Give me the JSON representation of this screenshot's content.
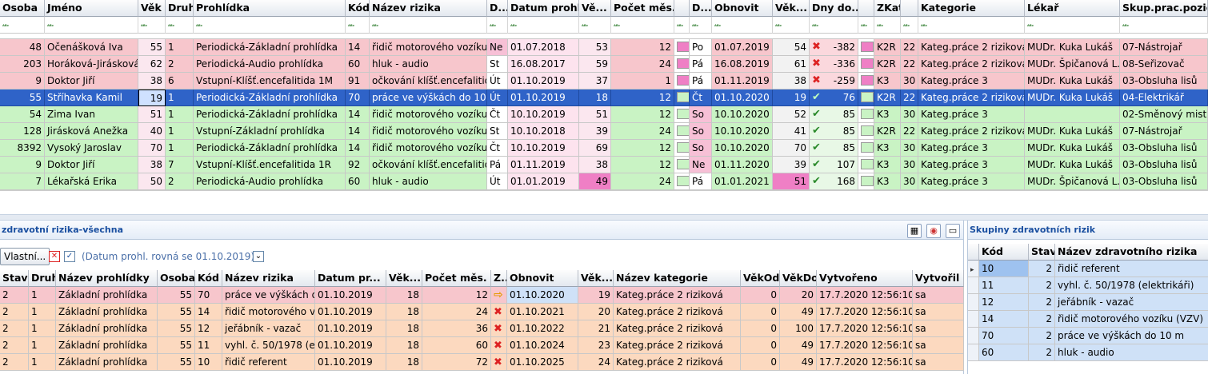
{
  "main_grid": {
    "columns": [
      "Osoba",
      "Jméno",
      "Věk",
      "Druh",
      "Prohlídka",
      "Kód",
      "Název rizika",
      "D...",
      "Datum prohl.",
      "Vě...",
      "Počet měs.",
      "",
      "D...",
      "Obnovit",
      "Věk...",
      "Dny do...",
      "",
      "ZKat",
      "",
      "Kategorie",
      "Lékař",
      "Skup.prac.pozic."
    ],
    "rows": [
      {
        "osoba": "48",
        "jmeno": "Očenášková Iva",
        "vek": "55",
        "druh": "1",
        "prohlidka": "Periodická-Základní prohlídka",
        "kod": "14",
        "riziko": "řidič motorového vozíku (",
        "d1": "Ne",
        "datum": "01.07.2018",
        "ve": "53",
        "pocet": "12",
        "d2": "Po",
        "obnovit": "01.07.2019",
        "vek2": "54",
        "stav": "x",
        "dny": "-382",
        "zkat": "K2R",
        "k": "22",
        "kategorie": "Kateg.práce 2 riziková",
        "lekar": "MUDr. Kuka Lukáš",
        "skup": "07-Nástrojař"
      },
      {
        "osoba": "203",
        "jmeno": "Horáková-Jirásková",
        "vek": "62",
        "druh": "2",
        "prohlidka": "Periodická-Audio     prohlídka",
        "kod": "60",
        "riziko": "hluk - audio",
        "d1": "St",
        "datum": "16.08.2017",
        "ve": "59",
        "pocet": "24",
        "d2": "Pá",
        "obnovit": "16.08.2019",
        "vek2": "61",
        "stav": "x",
        "dny": "-336",
        "zkat": "K2R",
        "k": "22",
        "kategorie": "Kateg.práce 2 riziková",
        "lekar": "MUDr. Špičanová L.",
        "skup": "08-Seřizovač"
      },
      {
        "osoba": "9",
        "jmeno": "Doktor Jiří",
        "vek": "38",
        "druh": "6",
        "prohlidka": "Vstupní-Klíšť.encefalitida 1M",
        "kod": "91",
        "riziko": "očkování klíšť.encefalitid",
        "d1": "Út",
        "datum": "01.10.2019",
        "ve": "37",
        "pocet": "1",
        "d2": "Pá",
        "obnovit": "01.11.2019",
        "vek2": "38",
        "stav": "x",
        "dny": "-259",
        "zkat": "K3",
        "k": "30",
        "kategorie": "Kateg.práce 3",
        "lekar": "MUDr. Kuka Lukáš",
        "skup": "03-Obsluha lisů"
      },
      {
        "osoba": "55",
        "jmeno": "Stříhavka Kamil",
        "vek": "19",
        "druh": "1",
        "prohlidka": "Periodická-Základní prohlídka",
        "kod": "70",
        "riziko": "práce ve výškách do 10 m",
        "d1": "Út",
        "datum": "01.10.2019",
        "ve": "18",
        "pocet": "12",
        "d2": "Čt",
        "obnovit": "01.10.2020",
        "vek2": "19",
        "stav": "ok",
        "dny": "76",
        "zkat": "K2R",
        "k": "22",
        "kategorie": "Kateg.práce 2 riziková",
        "lekar": "MUDr. Kuka Lukáš",
        "skup": "04-Elektrikář"
      },
      {
        "osoba": "54",
        "jmeno": "Zima Ivan",
        "vek": "51",
        "druh": "1",
        "prohlidka": "Periodická-Základní prohlídka",
        "kod": "14",
        "riziko": "řidič motorového vozíku (",
        "d1": "Čt",
        "datum": "10.10.2019",
        "ve": "51",
        "pocet": "12",
        "d2": "So",
        "obnovit": "10.10.2020",
        "vek2": "52",
        "stav": "ok",
        "dny": "85",
        "zkat": "K3",
        "k": "30",
        "kategorie": "Kateg.práce 3",
        "lekar": "",
        "skup": "02-Směnový mistr"
      },
      {
        "osoba": "128",
        "jmeno": "Jirásková Anežka",
        "vek": "40",
        "druh": "1",
        "prohlidka": "Vstupní-Základní prohlídka",
        "kod": "14",
        "riziko": "řidič motorového vozíku (",
        "d1": "St",
        "datum": "10.10.2018",
        "ve": "39",
        "pocet": "24",
        "d2": "So",
        "obnovit": "10.10.2020",
        "vek2": "41",
        "stav": "ok",
        "dny": "85",
        "zkat": "K2R",
        "k": "22",
        "kategorie": "Kateg.práce 2 riziková",
        "lekar": "MUDr. Kuka Lukáš",
        "skup": "07-Nástrojař"
      },
      {
        "osoba": "8392",
        "jmeno": "Vysoký Jaroslav",
        "vek": "70",
        "druh": "1",
        "prohlidka": "Periodická-Základní prohlídka",
        "kod": "14",
        "riziko": "řidič motorového vozíku (",
        "d1": "Čt",
        "datum": "10.10.2019",
        "ve": "69",
        "pocet": "12",
        "d2": "So",
        "obnovit": "10.10.2020",
        "vek2": "70",
        "stav": "ok",
        "dny": "85",
        "zkat": "K3",
        "k": "30",
        "kategorie": "Kateg.práce 3",
        "lekar": "MUDr. Kuka Lukáš",
        "skup": "03-Obsluha lisů"
      },
      {
        "osoba": "9",
        "jmeno": "Doktor Jiří",
        "vek": "38",
        "druh": "7",
        "prohlidka": "Vstupní-Klíšť.encefalitida 1R",
        "kod": "92",
        "riziko": "očkování klíšť.encefalitid",
        "d1": "Pá",
        "datum": "01.11.2019",
        "ve": "38",
        "pocet": "12",
        "d2": "Ne",
        "obnovit": "01.11.2020",
        "vek2": "39",
        "stav": "ok",
        "dny": "107",
        "zkat": "K3",
        "k": "30",
        "kategorie": "Kateg.práce 3",
        "lekar": "MUDr. Kuka Lukáš",
        "skup": "03-Obsluha lisů"
      },
      {
        "osoba": "7",
        "jmeno": "Lékařská Erika",
        "vek": "50",
        "druh": "2",
        "prohlidka": "Periodická-Audio     prohlídka",
        "kod": "60",
        "riziko": "hluk - audio",
        "d1": "Út",
        "datum": "01.01.2019",
        "ve": "49",
        "pocet": "24",
        "d2": "Pá",
        "obnovit": "01.01.2021",
        "vek2": "51",
        "stav": "ok",
        "dny": "168",
        "zkat": "K3",
        "k": "30",
        "kategorie": "Kateg.práce 3",
        "lekar": "MUDr. Špičanová L.",
        "skup": "03-Obsluha lisů"
      }
    ]
  },
  "left_panel": {
    "title": "zdravotní rizika-všechna",
    "vlastni_label": "Vlastní...",
    "filter_text": "(Datum prohl. rovná se 01.10.2019)",
    "columns": [
      "Stav",
      "Druh",
      "Název prohlídky",
      "Osoba",
      "Kód",
      "Název rizika",
      "Datum pr...",
      "Věk...",
      "Počet měs.",
      "Z...",
      "Obnovit",
      "Věk...",
      "Název kategorie",
      "VěkOd",
      "VěkDo",
      "Vytvořeno",
      "Vytvořil"
    ],
    "rows": [
      {
        "stav": "2",
        "druh": "1",
        "nazev": "Základní prohlídka",
        "osoba": "55",
        "kod": "70",
        "riziko": "práce ve výškách d",
        "datum": "01.10.2019",
        "vek": "18",
        "pocet": "12",
        "z": "arrow",
        "obnovit": "01.10.2020",
        "vek2": "19",
        "kategorie": "Kateg.práce 2 riziková",
        "od": "0",
        "do": "20",
        "vytvoreno": "17.7.2020 12:56:10",
        "vytvoril": "sa"
      },
      {
        "stav": "2",
        "druh": "1",
        "nazev": "Základní prohlídka",
        "osoba": "55",
        "kod": "14",
        "riziko": "řidič motorového vo",
        "datum": "01.10.2019",
        "vek": "18",
        "pocet": "24",
        "z": "x",
        "obnovit": "01.10.2021",
        "vek2": "20",
        "kategorie": "Kateg.práce 2 riziková",
        "od": "0",
        "do": "49",
        "vytvoreno": "17.7.2020 12:56:10",
        "vytvoril": "sa"
      },
      {
        "stav": "2",
        "druh": "1",
        "nazev": "Základní prohlídka",
        "osoba": "55",
        "kod": "12",
        "riziko": "jeřábník - vazač",
        "datum": "01.10.2019",
        "vek": "18",
        "pocet": "36",
        "z": "x",
        "obnovit": "01.10.2022",
        "vek2": "21",
        "kategorie": "Kateg.práce 2 riziková",
        "od": "0",
        "do": "100",
        "vytvoreno": "17.7.2020 12:56:10",
        "vytvoril": "sa"
      },
      {
        "stav": "2",
        "druh": "1",
        "nazev": "Základní prohlídka",
        "osoba": "55",
        "kod": "11",
        "riziko": "vyhl. č. 50/1978 (el",
        "datum": "01.10.2019",
        "vek": "18",
        "pocet": "60",
        "z": "x",
        "obnovit": "01.10.2024",
        "vek2": "23",
        "kategorie": "Kateg.práce 2 riziková",
        "od": "0",
        "do": "49",
        "vytvoreno": "17.7.2020 12:56:10",
        "vytvoril": "sa"
      },
      {
        "stav": "2",
        "druh": "1",
        "nazev": "Základní prohlídka",
        "osoba": "55",
        "kod": "10",
        "riziko": "řidič referent",
        "datum": "01.10.2019",
        "vek": "18",
        "pocet": "72",
        "z": "x",
        "obnovit": "01.10.2025",
        "vek2": "24",
        "kategorie": "Kateg.práce 2 riziková",
        "od": "0",
        "do": "49",
        "vytvoreno": "17.7.2020 12:56:10",
        "vytvoril": "sa"
      }
    ]
  },
  "right_panel": {
    "title": "Skupiny zdravotních rizik",
    "columns": [
      "Kód",
      "Stav",
      "Název zdravotního rizika"
    ],
    "rows": [
      {
        "kod": "10",
        "stav": "2",
        "nazev": "řidič referent"
      },
      {
        "kod": "11",
        "stav": "2",
        "nazev": "vyhl. č. 50/1978 (elektrikáři)"
      },
      {
        "kod": "12",
        "stav": "2",
        "nazev": "jeřábník - vazač"
      },
      {
        "kod": "14",
        "stav": "2",
        "nazev": "řidič motorového vozíku (VZV)"
      },
      {
        "kod": "70",
        "stav": "2",
        "nazev": "práce ve výškách do 10 m"
      },
      {
        "kod": "60",
        "stav": "2",
        "nazev": "hluk - audio"
      }
    ]
  },
  "colors": {
    "row_red": "#f7c6cc",
    "row_green": "#c9f3c4",
    "row_orange": "#fcd9bf",
    "selected": "#2f63c8",
    "pink": "#ef7fc5",
    "light_pink": "#f8d9e8",
    "blue_light": "#cfe1f7"
  },
  "icons": {
    "filter": "abc-filter-icon",
    "expired": "red-x-icon",
    "valid": "green-check-icon",
    "due": "orange-arrow-icon"
  }
}
